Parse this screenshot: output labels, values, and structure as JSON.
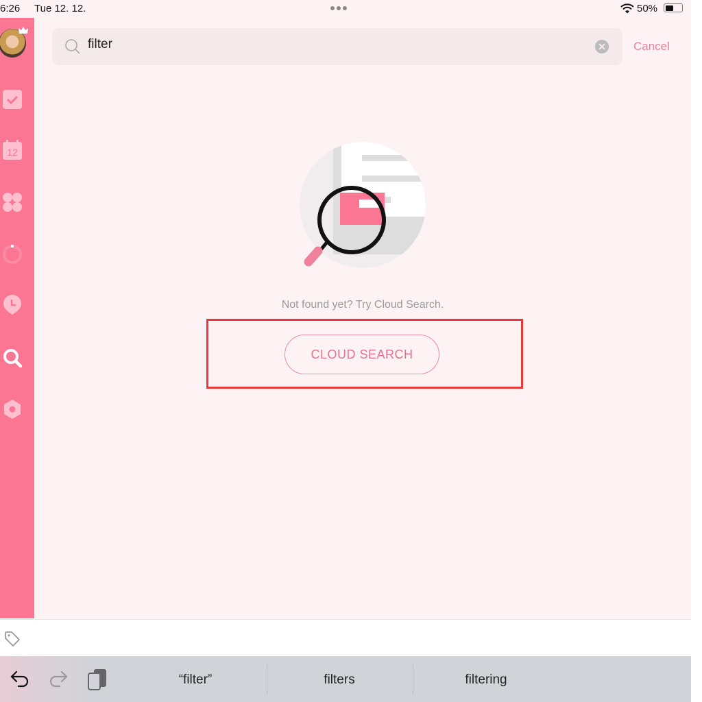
{
  "status_bar": {
    "time": "6:26",
    "date": "Tue 12. 12.",
    "battery": "50%",
    "battery_level": 0.5,
    "wifi_icon": "wifi-icon"
  },
  "search": {
    "query": "filter",
    "placeholder": "",
    "cancel_label": "Cancel"
  },
  "sidebar": {
    "items": [
      {
        "name": "tasks",
        "icon": "checkbox-icon"
      },
      {
        "name": "calendar",
        "icon": "calendar-icon",
        "label": "12"
      },
      {
        "name": "apps",
        "icon": "grid-icon"
      },
      {
        "name": "progress",
        "icon": "ring-icon"
      },
      {
        "name": "time",
        "icon": "clock-icon"
      },
      {
        "name": "search",
        "icon": "search-icon",
        "active": true
      },
      {
        "name": "settings",
        "icon": "gear-icon"
      }
    ]
  },
  "empty_state": {
    "hint": "Not found yet? Try Cloud Search.",
    "button_label": "CLOUD SEARCH"
  },
  "keyboard": {
    "suggestions": [
      "“filter”",
      "filters",
      "filtering"
    ]
  },
  "colors": {
    "accent": "#fb7693",
    "background": "#fdf3f4",
    "highlight": "#e53a3a"
  }
}
